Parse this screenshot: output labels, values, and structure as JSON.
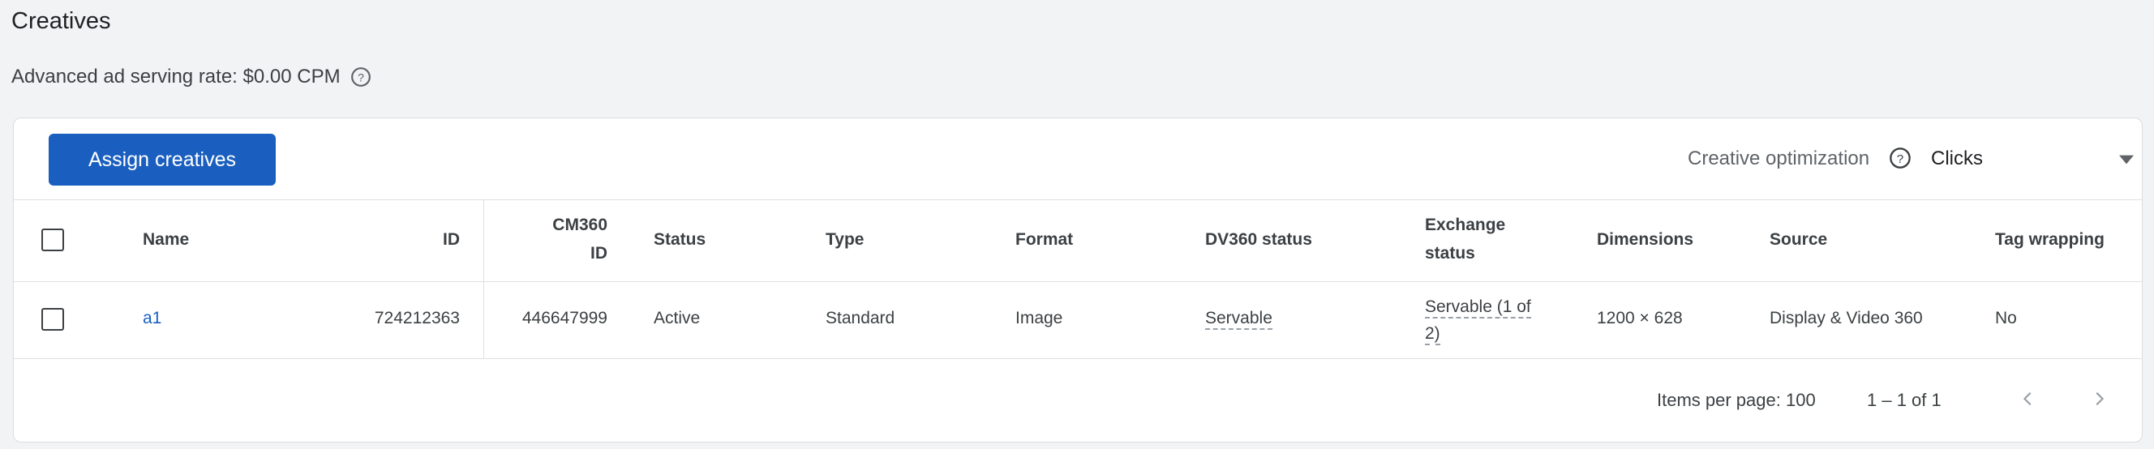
{
  "page": {
    "title": "Creatives",
    "serving_rate": "Advanced ad serving rate: $0.00 CPM"
  },
  "toolbar": {
    "assign_label": "Assign creatives",
    "optimization_label": "Creative optimization",
    "optimization_value": "Clicks"
  },
  "table": {
    "headers": {
      "name": "Name",
      "id": "ID",
      "cm360_line1": "CM360",
      "cm360_line2": "ID",
      "status": "Status",
      "type": "Type",
      "format": "Format",
      "dv360_status": "DV360 status",
      "exchange_line1": "Exchange",
      "exchange_line2": "status",
      "dimensions": "Dimensions",
      "source": "Source",
      "tag_wrapping": "Tag wrapping"
    },
    "rows": [
      {
        "name": "a1",
        "id": "724212363",
        "cm360_id": "446647999",
        "status": "Active",
        "type": "Standard",
        "format": "Image",
        "dv360_status": "Servable",
        "exchange_line1": "Servable (1 of",
        "exchange_line2": "2)",
        "dimensions": "1200 × 628",
        "source": "Display & Video 360",
        "tag_wrapping": "No"
      }
    ]
  },
  "pagination": {
    "items_per_page": "Items per page: 100",
    "range": "1 – 1 of 1"
  },
  "colors": {
    "primary": "#1a5fbf",
    "background": "#f1f3f4"
  }
}
